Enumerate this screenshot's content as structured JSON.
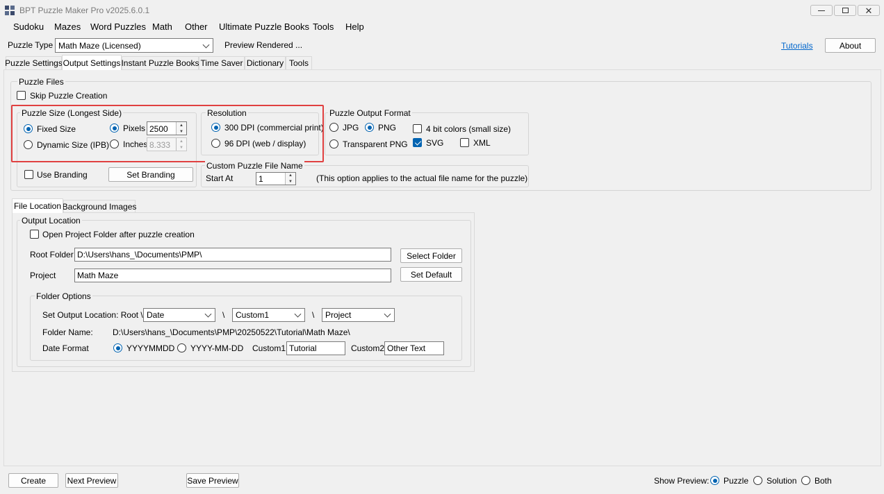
{
  "window": {
    "title": "BPT Puzzle Maker Pro v2025.6.0.1"
  },
  "menu": [
    "Sudoku",
    "Mazes",
    "Word Puzzles",
    "Math",
    "Other",
    "Ultimate Puzzle Books",
    "Tools",
    "Help"
  ],
  "toolbar": {
    "puzzle_type_label": "Puzzle Type",
    "puzzle_type_value": "Math Maze (Licensed)",
    "preview_status": "Preview Rendered ...",
    "tutorials_link": "Tutorials",
    "about_button": "About"
  },
  "tabs": [
    "Puzzle Settings",
    "Output Settings",
    "Instant Puzzle Books",
    "Time Saver",
    "Dictionary",
    "Tools"
  ],
  "puzzle_files": {
    "title": "Puzzle Files",
    "skip_creation": "Skip Puzzle Creation",
    "puzzle_size": {
      "title": "Puzzle Size (Longest Side)",
      "fixed_size": "Fixed Size",
      "dynamic_size": "Dynamic Size (IPB)",
      "pixels": "Pixels",
      "pixels_value": "2500",
      "inches": "Inches",
      "inches_value": "8.333"
    },
    "resolution": {
      "title": "Resolution",
      "dpi300": "300 DPI (commercial print)",
      "dpi96": "96  DPI (web / display)"
    },
    "output_format": {
      "title": "Puzzle Output Format",
      "jpg": "JPG",
      "png": "PNG",
      "transparent_png": "Transparent PNG",
      "four_bit": "4 bit colors (small size)",
      "svg": "SVG",
      "xml": "XML"
    },
    "branding": {
      "use_branding": "Use Branding",
      "set_branding": "Set Branding"
    },
    "custom_name": {
      "title": "Custom Puzzle File Name",
      "start_at_label": "Start At",
      "start_at_value": "1",
      "note": "(This option applies to the actual file name for the puzzle)"
    }
  },
  "subtabs": [
    "File Location",
    "Background Images"
  ],
  "output_location": {
    "title": "Output Location",
    "open_folder": "Open Project Folder after puzzle creation",
    "root_folder_label": "Root Folder",
    "root_folder_value": "D:\\Users\\hans_\\Documents\\PMP\\",
    "select_folder": "Select Folder",
    "project_label": "Project",
    "project_value": "Math Maze",
    "set_default": "Set Default",
    "folder_options": {
      "title": "Folder Options",
      "set_location_label": "Set Output Location: Root \\",
      "sel1": "Date",
      "sep1": "\\",
      "sel2": "Custom1",
      "sep2": "\\",
      "sel3": "Project",
      "folder_name_label": "Folder Name:",
      "folder_name_value": "D:\\Users\\hans_\\Documents\\PMP\\20250522\\Tutorial\\Math Maze\\",
      "date_format_label": "Date Format",
      "fmt1": "YYYYMMDD",
      "fmt2": "YYYY-MM-DD",
      "custom1_label": "Custom1:",
      "custom1_value": "Tutorial",
      "custom2_label": "Custom2:",
      "custom2_value": "Other Text"
    }
  },
  "footer": {
    "create": "Create",
    "next_preview": "Next Preview",
    "save_preview": "Save Preview",
    "show_preview_label": "Show Preview:",
    "puzzle": "Puzzle",
    "solution": "Solution",
    "both": "Both"
  },
  "colors": {
    "accent": "#0063b1",
    "highlight": "#e04040",
    "link": "#0066cc"
  }
}
